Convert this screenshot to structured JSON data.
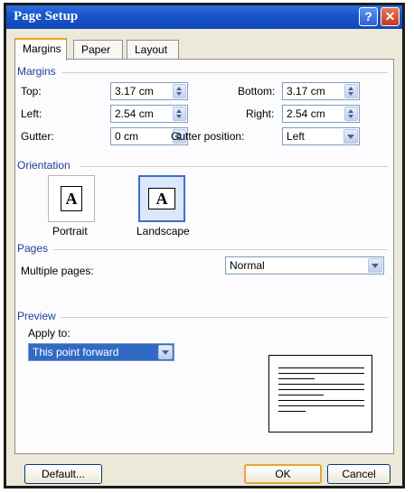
{
  "window": {
    "title": "Page Setup"
  },
  "tabs": [
    {
      "label": "Margins"
    },
    {
      "label": "Paper"
    },
    {
      "label": "Layout"
    }
  ],
  "margins": {
    "group_label": "Margins",
    "top": {
      "label": "Top:",
      "value": "3.17 cm"
    },
    "bottom": {
      "label": "Bottom:",
      "value": "3.17 cm"
    },
    "left": {
      "label": "Left:",
      "value": "2.54 cm"
    },
    "right": {
      "label": "Right:",
      "value": "2.54 cm"
    },
    "gutter": {
      "label": "Gutter:",
      "value": "0 cm"
    },
    "gutter_position": {
      "label": "Gutter position:",
      "value": "Left"
    }
  },
  "orientation": {
    "group_label": "Orientation",
    "portrait": {
      "label": "Portrait",
      "glyph": "A"
    },
    "landscape": {
      "label": "Landscape",
      "glyph": "A"
    },
    "selected": "landscape"
  },
  "pages": {
    "group_label": "Pages",
    "multiple_pages": {
      "label": "Multiple pages:",
      "value": "Normal"
    }
  },
  "preview": {
    "group_label": "Preview",
    "apply_to": {
      "label": "Apply to:",
      "value": "This point forward"
    }
  },
  "buttons": {
    "default": "Default...",
    "ok": "OK",
    "cancel": "Cancel"
  },
  "titlebar_buttons": {
    "help": "?",
    "close": "✕"
  },
  "colors": {
    "title_bar": "#1a56c9",
    "group_label": "#1f3d9a",
    "selected_highlight": "#316ac5",
    "tab_accent": "#f0a31e"
  }
}
